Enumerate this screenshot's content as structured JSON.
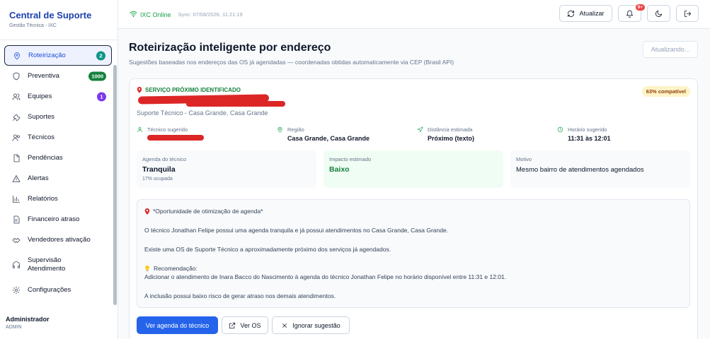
{
  "sidebar": {
    "brand_title": "Central de Suporte",
    "brand_subtitle": "Gestão Técnica - IXC",
    "items": [
      {
        "label": "Roteirização",
        "badge": "2",
        "icon": "map-pin-icon",
        "active": true
      },
      {
        "label": "Preventiva",
        "badge": "1000",
        "icon": "shield-icon"
      },
      {
        "label": "Equipes",
        "badge": "1",
        "icon": "users-icon"
      },
      {
        "label": "Suportes",
        "icon": "wrench-icon"
      },
      {
        "label": "Técnicos",
        "icon": "user-group-icon"
      },
      {
        "label": "Pendências",
        "icon": "file-icon"
      },
      {
        "label": "Alertas",
        "icon": "alert-triangle-icon"
      },
      {
        "label": "Relatórios",
        "icon": "bar-chart-icon"
      },
      {
        "label": "Financeiro atraso",
        "icon": "document-icon"
      },
      {
        "label": "Vendedores ativação",
        "icon": "handshake-icon"
      },
      {
        "label": "Supervisão Atendimento",
        "icon": "headphones-icon"
      },
      {
        "label": "Configurações",
        "icon": "gear-icon"
      }
    ],
    "user_name": "Administrador",
    "user_role": "ADMIN"
  },
  "topbar": {
    "status": "IXC Online",
    "sync": "Sync: 07/08/2026, 11:21:19",
    "refresh_label": "Atualizar",
    "notification_count": "9+"
  },
  "main": {
    "title": "Roteirização inteligente por endereço",
    "subtitle": "Sugestões baseadas nos endereços das OS já agendadas — coordenadas obtidas automaticamente via CEP (Brasil API)",
    "updating_label": "Atualizando...",
    "card": {
      "tag": "SERVIÇO PRÓXIMO IDENTIFICADO",
      "service_subtitle": "Suporte Técnico - Casa Grande, Casa Grande",
      "compatibility": "63% compatível",
      "info": {
        "tech_label": "Técnico sugerido",
        "region_label": "Região",
        "region_value": "Casa Grande, Casa Grande",
        "distance_label": "Distância estimada",
        "distance_value": "Próximo (texto)",
        "time_label": "Horário sugerido",
        "time_value": "11:31 às 12:01"
      },
      "metrics": {
        "agenda_label": "Agenda do técnico",
        "agenda_value": "Tranquila",
        "agenda_sub": "17% ocupada",
        "impact_label": "Impacto estimado",
        "impact_value": "Baixo",
        "reason_label": "Motivo",
        "reason_value": "Mesmo bairro de atendimentos agendados"
      },
      "opportunity": {
        "title": "*Oportunidade de otimização de agenda*",
        "line1": "O técnico Jonathan Felipe possui uma agenda tranquila e já possui atendimentos no Casa Grande, Casa Grande.",
        "line2": "Existe uma OS de Suporte Técnico a aproximadamente próximo dos serviços já agendados.",
        "rec_label": "Recomendação:",
        "rec_text": "Adicionar o atendimento de Inara Bacco do Nascimento à agenda do técnico Jonathan Felipe no horário disponível entre 11:31 e 12:01.",
        "line3": "A inclusão possui baixo risco de gerar atraso nos demais atendimentos."
      },
      "actions": {
        "primary": "Ver agenda do técnico",
        "view_os": "Ver OS",
        "ignore": "Ignorar sugestão"
      }
    }
  }
}
